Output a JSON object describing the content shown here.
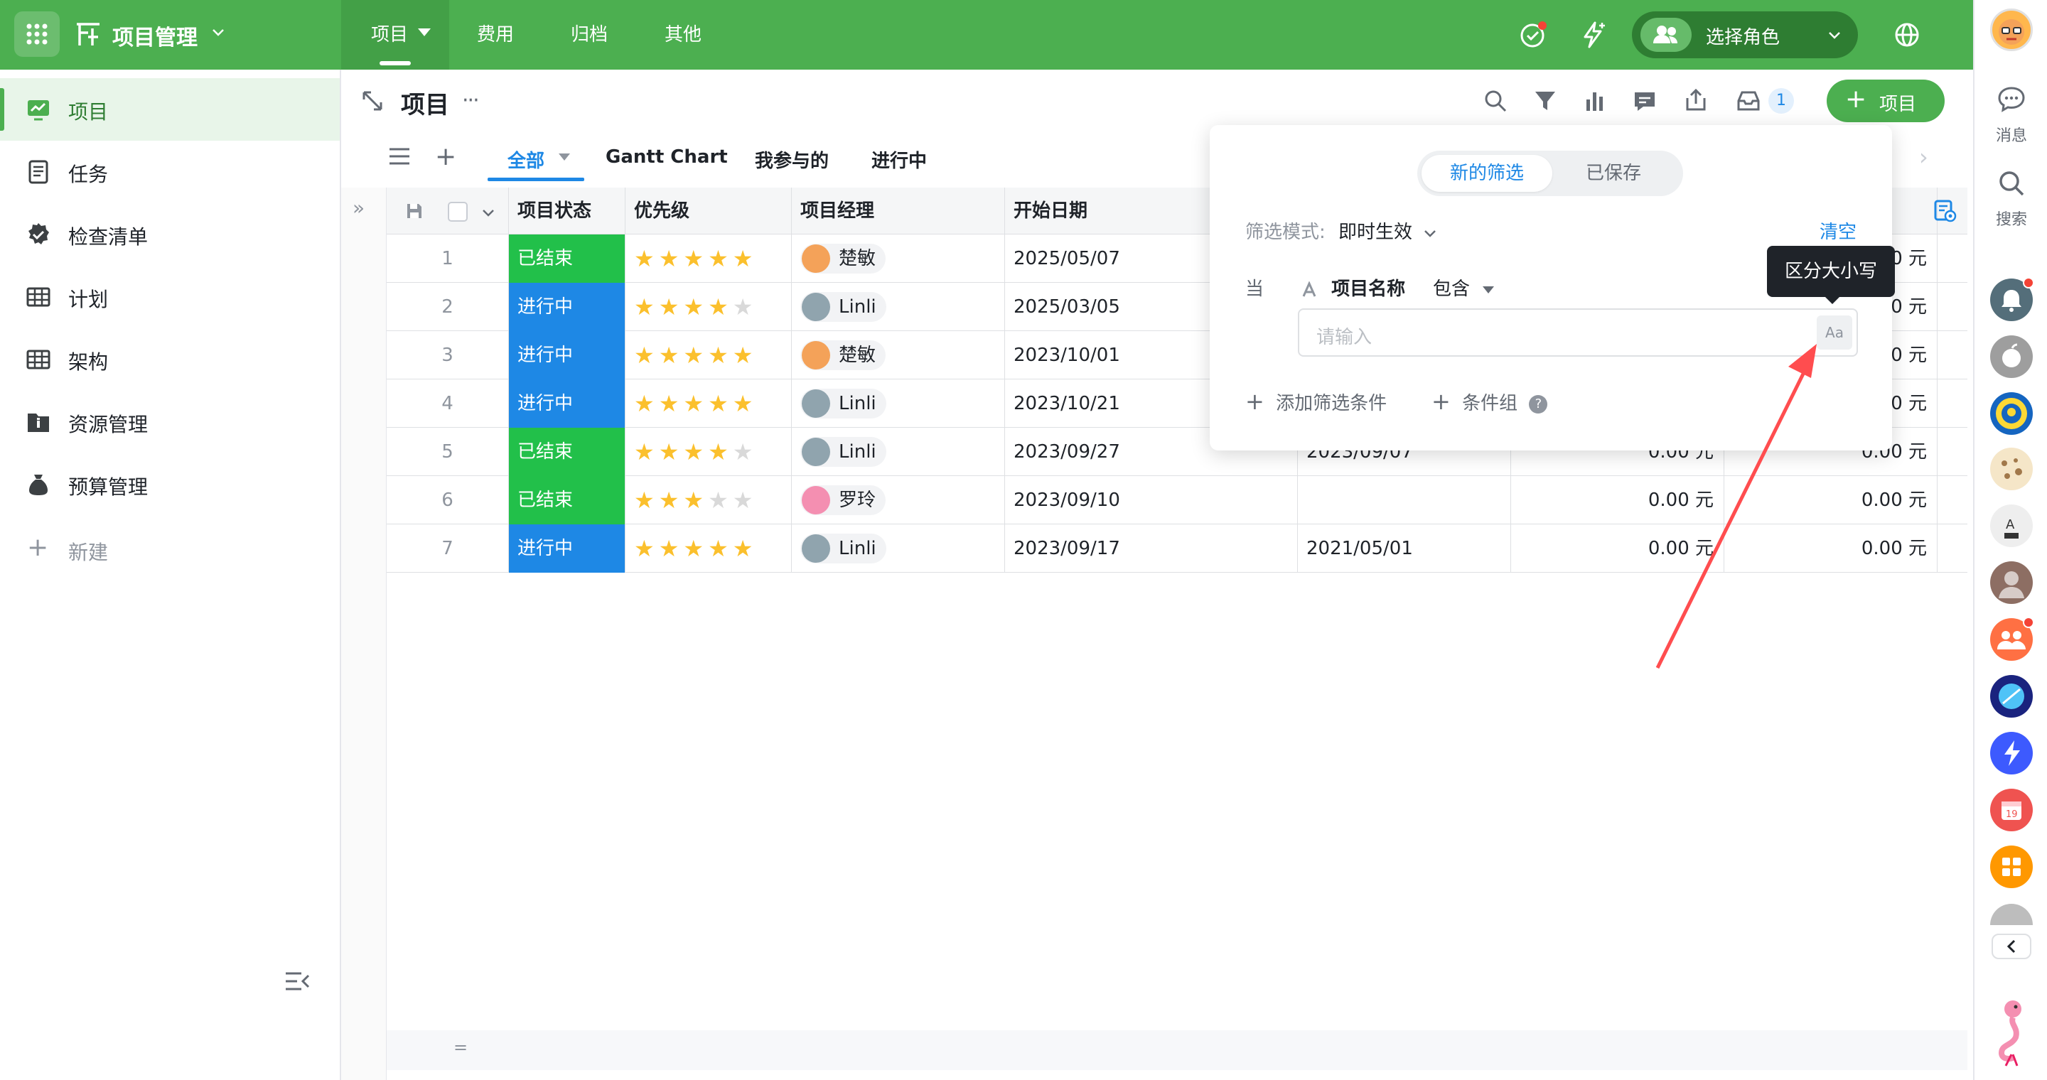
{
  "topbar": {
    "app_title": "项目管理",
    "tabs": [
      "项目",
      "费用",
      "归档",
      "其他"
    ],
    "role_label": "选择角色"
  },
  "rail": {
    "messages_label": "消息",
    "search_label": "搜索"
  },
  "sidebar": {
    "items": [
      {
        "label": "项目",
        "icon": "dashboard-icon"
      },
      {
        "label": "任务",
        "icon": "document-icon"
      },
      {
        "label": "检查清单",
        "icon": "checklist-badge-icon"
      },
      {
        "label": "计划",
        "icon": "grid-table-icon"
      },
      {
        "label": "架构",
        "icon": "grid-table-icon"
      },
      {
        "label": "资源管理",
        "icon": "info-folder-icon"
      },
      {
        "label": "预算管理",
        "icon": "money-bag-icon"
      }
    ],
    "new_label": "新建"
  },
  "header": {
    "title": "项目",
    "more": "···",
    "notify_count": "1",
    "add_button_label": "项目"
  },
  "views": {
    "tabs": [
      "全部",
      "Gantt Chart",
      "我参与的",
      "进行中"
    ]
  },
  "table": {
    "columns": [
      "项目状态",
      "优先级",
      "项目经理",
      "开始日期"
    ],
    "rows": [
      {
        "num": "1",
        "status": "已结束",
        "stars": 5,
        "manager": "楚敏",
        "start": "2025/05/07",
        "date2": "",
        "amount1": "",
        "amount2": "0.00 元"
      },
      {
        "num": "2",
        "status": "进行中",
        "stars": 4,
        "manager": "Linli",
        "start": "2025/03/05",
        "date2": "",
        "amount1": "",
        "amount2": "0.00 元"
      },
      {
        "num": "3",
        "status": "进行中",
        "stars": 5,
        "manager": "楚敏",
        "start": "2023/10/01",
        "date2": "",
        "amount1": "",
        "amount2": "0.00 元"
      },
      {
        "num": "4",
        "status": "进行中",
        "stars": 5,
        "manager": "Linli",
        "start": "2023/10/21",
        "date2": "",
        "amount1": "",
        "amount2": "0.00 元"
      },
      {
        "num": "5",
        "status": "已结束",
        "stars": 4,
        "manager": "Linli",
        "start": "2023/09/27",
        "date2": "2023/09/07",
        "amount1": "0.00 元",
        "amount2": "0.00 元"
      },
      {
        "num": "6",
        "status": "已结束",
        "stars": 3,
        "manager": "罗玲",
        "start": "2023/09/10",
        "date2": "",
        "amount1": "0.00 元",
        "amount2": "0.00 元"
      },
      {
        "num": "7",
        "status": "进行中",
        "stars": 5,
        "manager": "Linli",
        "start": "2023/09/17",
        "date2": "2021/05/01",
        "amount1": "0.00 元",
        "amount2": "0.00 元"
      }
    ],
    "footer": "="
  },
  "filter": {
    "segment_new": "新的筛选",
    "segment_saved": "已保存",
    "mode_label": "筛选模式:",
    "mode_value": "即时生效",
    "clear_label": "清空",
    "when_label": "当",
    "field_label": "项目名称",
    "operator_label": "包含",
    "input_placeholder": "请输入",
    "case_button": "Aa",
    "add_condition_label": "添加筛选条件",
    "condition_group_label": "条件组",
    "help": "?",
    "tooltip": "区分大小写"
  },
  "colors": {
    "brand_green": "#4caf50",
    "status_done": "#22c04a",
    "status_active": "#1e88e5",
    "star": "#fbc02d",
    "annotation_arrow": "#ff4d4f"
  }
}
